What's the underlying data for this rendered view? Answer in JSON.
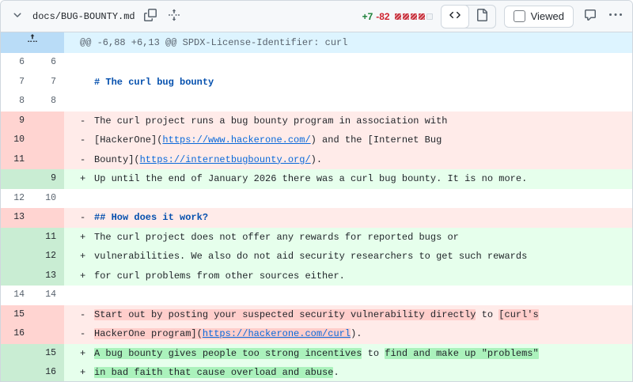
{
  "header": {
    "filename": "docs/BUG-BOUNTY.md",
    "diffstat": {
      "additions": "+7",
      "deletions": "-82"
    },
    "viewed_label": "Viewed"
  },
  "hunk": {
    "label": "@@ -6,88 +6,13 @@ SPDX-License-Identifier: curl"
  },
  "rows": [
    {
      "old": "6",
      "new": "6",
      "sign": "",
      "text": ""
    },
    {
      "old": "7",
      "new": "7",
      "sign": "",
      "heading": "# The curl bug bounty"
    },
    {
      "old": "8",
      "new": "8",
      "sign": "",
      "text": ""
    },
    {
      "old": "9",
      "new": "",
      "sign": "-",
      "p1": "The curl project runs a bug bounty program in association with"
    },
    {
      "old": "10",
      "new": "",
      "sign": "-",
      "p1": "[HackerOne](",
      "l": "https://www.hackerone.com/",
      "p2": ") and the [Internet Bug"
    },
    {
      "old": "11",
      "new": "",
      "sign": "-",
      "p1": "Bounty](",
      "l": "https://internetbugbounty.org/",
      "p2": ")."
    },
    {
      "old": "",
      "new": "9",
      "sign": "+",
      "p1": "Up until the end of January 2026 there was a curl bug bounty. It is no more."
    },
    {
      "old": "12",
      "new": "10",
      "sign": "",
      "text": ""
    },
    {
      "old": "13",
      "new": "",
      "sign": "-",
      "heading": "## How does it work?"
    },
    {
      "old": "",
      "new": "11",
      "sign": "+",
      "p1": "The curl project does not offer any rewards for reported bugs or"
    },
    {
      "old": "",
      "new": "12",
      "sign": "+",
      "p1": "vulnerabilities. We also do not aid security researchers to get such rewards"
    },
    {
      "old": "",
      "new": "13",
      "sign": "+",
      "p1": "for curl problems from other sources either."
    },
    {
      "old": "14",
      "new": "14",
      "sign": "",
      "text": ""
    },
    {
      "old": "15",
      "new": "",
      "sign": "-",
      "hl1": "Start out by posting your suspected security vulnerability directly",
      "mid": " to ",
      "hl2": "[curl's"
    },
    {
      "old": "16",
      "new": "",
      "sign": "-",
      "hl1": "HackerOne program](",
      "l": "https://hackerone.com/curl",
      "tail": ")."
    },
    {
      "old": "",
      "new": "15",
      "sign": "+",
      "hl1": "A bug bounty gives people too strong incentives",
      "mid": " to ",
      "hl2": "find and make up \"problems\""
    },
    {
      "old": "",
      "new": "16",
      "sign": "+",
      "hl1": "in bad faith that cause overload and abuse",
      "tail": "."
    }
  ],
  "colors": {
    "addition_bg": "#e6ffec",
    "addition_word": "#abf2bc",
    "deletion_bg": "#ffebe9",
    "deletion_word": "#ffcecb",
    "hunk_bg": "#ddf4ff",
    "link": "#0969da",
    "heading": "#0550ae",
    "adds_text": "#1a7f37",
    "dels_text": "#cf222e"
  }
}
